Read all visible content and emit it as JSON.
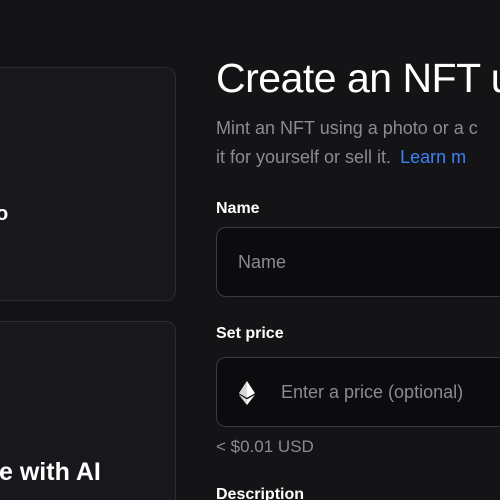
{
  "left_panel": {
    "top_card_fragment": "o",
    "bottom_card_title": "e with AI"
  },
  "header": {
    "title": "Create an NFT u",
    "subtitle_line1": "Mint an NFT using a photo or a c",
    "subtitle_line2": "it for yourself or sell it.",
    "learn_more": "Learn m"
  },
  "form": {
    "name_label": "Name",
    "name_placeholder": "Name",
    "price_label": "Set price",
    "price_placeholder": "Enter a price (optional)",
    "price_currency_icon": "ethereum-icon",
    "price_usd_hint": "< $0.01 USD",
    "description_label": "Description"
  },
  "colors": {
    "background": "#141417",
    "muted_text": "#8a8b93",
    "link": "#3b82f6",
    "input_border": "#3a3a40"
  }
}
